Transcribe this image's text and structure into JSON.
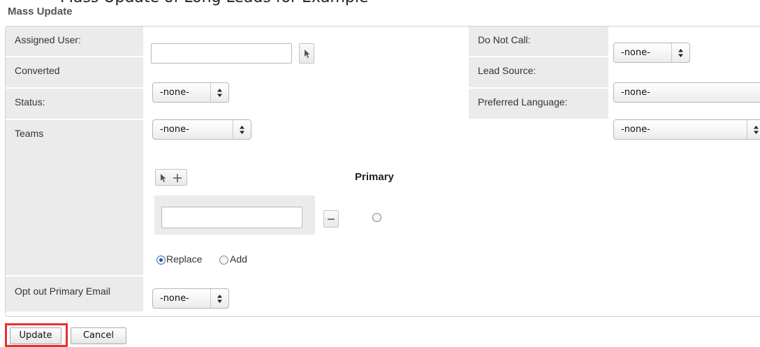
{
  "cut_header_text": "Mass Update of Long Leads for Example",
  "title": "Mass Update",
  "fields": {
    "assigned_user": {
      "label": "Assigned User:",
      "value": ""
    },
    "converted": {
      "label": "Converted",
      "selected": "-none-"
    },
    "status": {
      "label": "Status:",
      "selected": "-none-"
    },
    "teams": {
      "label": "Teams",
      "primary_label": "Primary",
      "value": "",
      "options": {
        "replace": "Replace",
        "add": "Add",
        "selected": "Replace"
      }
    },
    "opt_out_primary_email": {
      "label": "Opt out Primary Email",
      "selected": "-none-"
    },
    "do_not_call": {
      "label": "Do Not Call:",
      "selected": "-none-"
    },
    "lead_source": {
      "label": "Lead Source:",
      "selected": "-none-"
    },
    "preferred_language": {
      "label": "Preferred Language:",
      "selected": "-none-"
    }
  },
  "buttons": {
    "update": "Update",
    "cancel": "Cancel"
  },
  "icons": {
    "select_user": "cursor-arrow-icon",
    "add_team": "plus-icon",
    "remove_team": "minus-icon",
    "dropdown": "updown-arrow-icon"
  },
  "colors": {
    "label_bg": "#ebebeb",
    "panel_border": "#c9d4df",
    "highlight": "#e8302c"
  }
}
